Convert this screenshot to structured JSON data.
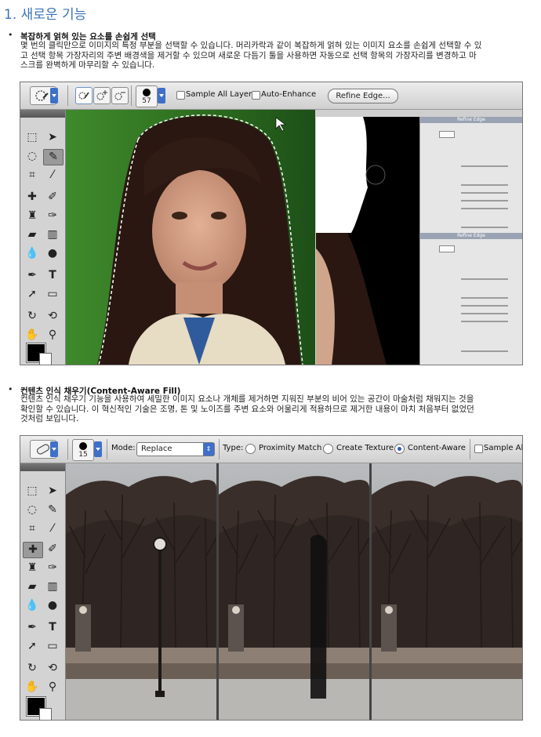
{
  "heading": "1. 새로운 기능",
  "features": [
    {
      "title": "복잡하게 얽혀 있는 요소를 손쉽게 선택",
      "lines": [
        "몇 번의 클릭만으로 이미지의 특정 부분을 선택할 수 있습니다. 머리카락과 같이 복잡하게 얽혀 있는 이미지 요소를 손쉽게 선택할 수 있",
        "고 선택 항목 가장자리의 주변 배경색을 제거할 수 있으며 새로운 다듬기 툴을 사용하면 자동으로 선택 항목의 가장자리를 변경하고 마",
        "스크를 완벽하게 마무리할 수 있습니다."
      ]
    },
    {
      "title": "컨텐츠 인식 채우기(Content-Aware Fill)",
      "lines": [
        "컨텐츠 인식 채우기 기능을 사용하여 세밀한 이미지 요소나 개체를 제거하면 지워진 부분의 비어 있는 공간이 마술처럼 채워지는 것을",
        "확인할 수 있습니다. 이 혁신적인 기술은 조명, 톤 및 노이즈를 주변 요소와 어울리게 적용하므로 제거한 내용이 마치 처음부터 없었던",
        "것처럼 보입니다."
      ]
    }
  ],
  "screenshot1": {
    "brush_size": "57",
    "sample_all_layers": "Sample All Layers",
    "auto_enhance": "Auto-Enhance",
    "refine_edge": "Refine Edge...",
    "panel_title": "Refine Edge",
    "panel_title2": "Refine Edge"
  },
  "screenshot2": {
    "brush_size": "15",
    "mode_label": "Mode:",
    "mode_value": "Replace",
    "type_label": "Type:",
    "types": [
      "Proximity Match",
      "Create Texture",
      "Content-Aware"
    ],
    "type_selected": "Content-Aware",
    "sample_all": "Sample All"
  },
  "tool_icons": [
    "marquee-icon",
    "move-icon",
    "lasso-icon",
    "quick-select-icon",
    "crop-icon",
    "eyedropper-icon",
    "healing-icon",
    "brush-icon",
    "stamp-icon",
    "history-brush-icon",
    "eraser-icon",
    "gradient-icon",
    "blur-icon",
    "dodge-icon",
    "pen-icon",
    "type-icon",
    "path-select-icon",
    "shape-icon",
    "3d-rotate-icon",
    "3d-orbit-icon",
    "hand-icon",
    "zoom-icon"
  ]
}
